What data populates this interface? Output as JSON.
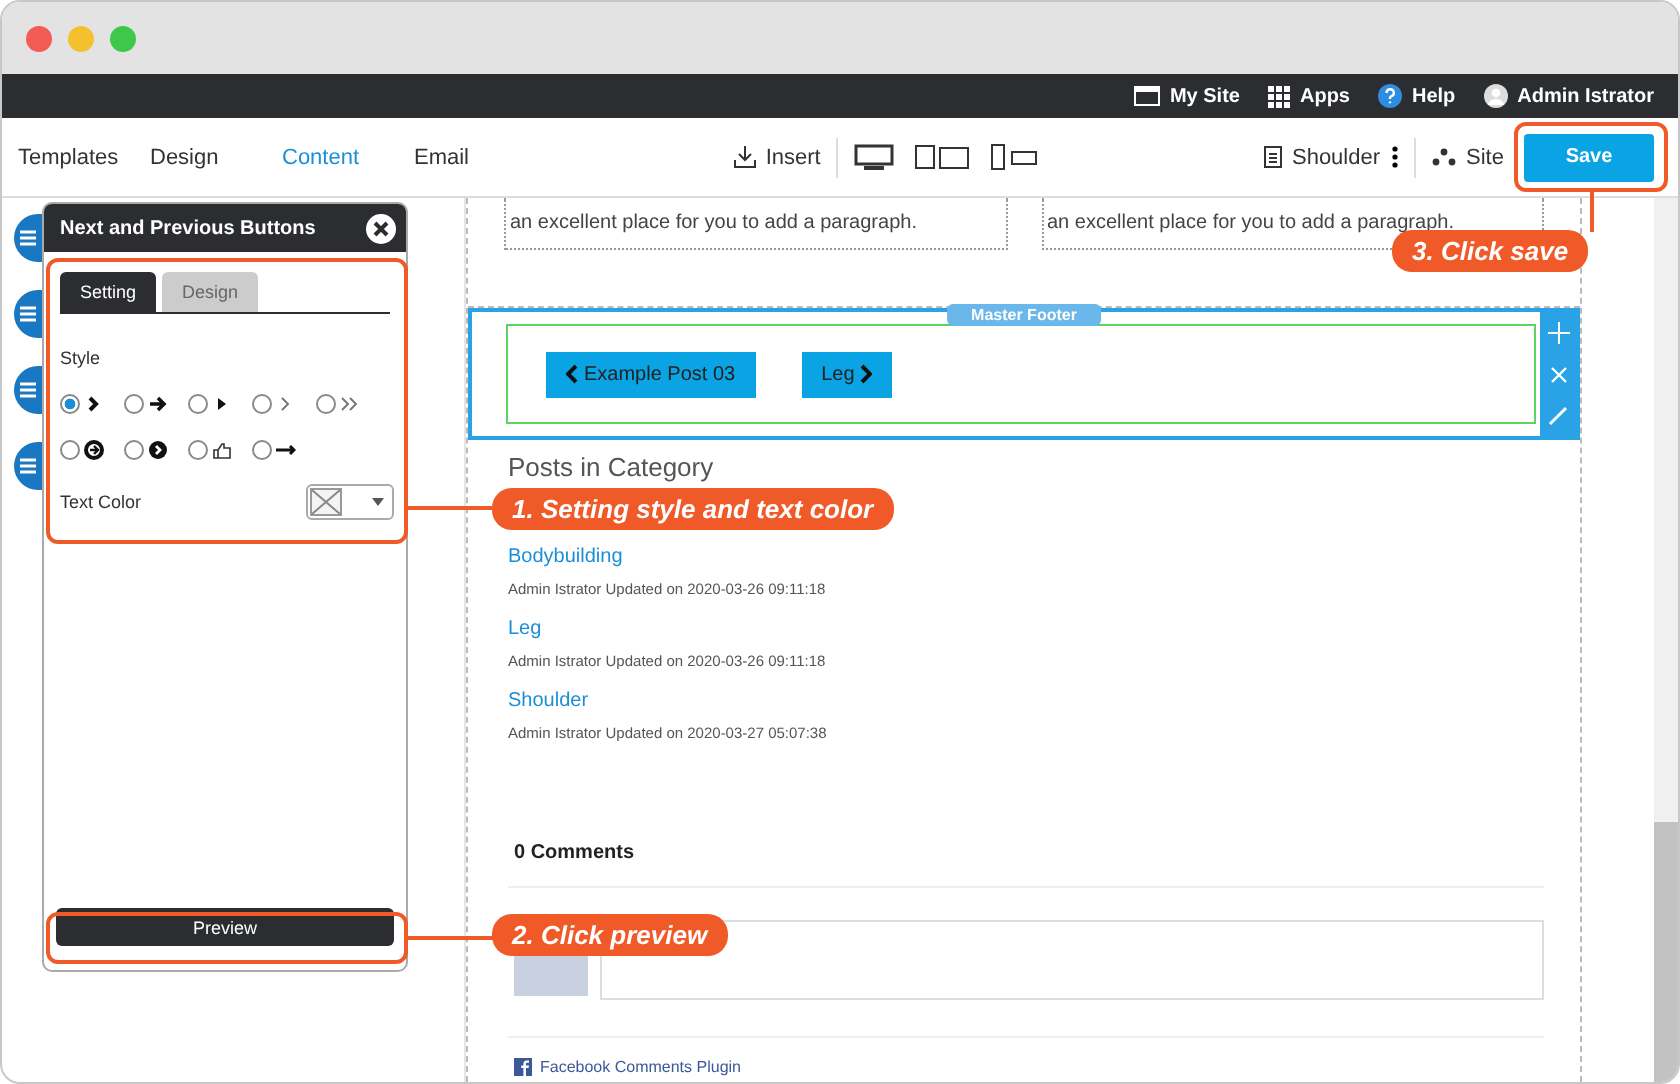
{
  "window": {
    "controls": [
      {
        "color": "#f25c54"
      },
      {
        "color": "#f5c02e"
      },
      {
        "color": "#3ec84a"
      }
    ]
  },
  "top_bar": {
    "items": [
      {
        "label": "My Site",
        "kind": "site"
      },
      {
        "label": "Apps",
        "kind": "apps"
      },
      {
        "label": "Help",
        "kind": "help"
      },
      {
        "label": "Admin Istrator",
        "kind": "user"
      }
    ]
  },
  "nav": {
    "tabs": [
      {
        "label": "Templates",
        "selected": false
      },
      {
        "label": "Design",
        "selected": false
      },
      {
        "label": "Content",
        "selected": true
      },
      {
        "label": "Email",
        "selected": false
      }
    ],
    "insert": "Insert",
    "page": "Shoulder",
    "site": "Site",
    "save": "Save"
  },
  "panel": {
    "title": "Next and Previous Buttons",
    "tabs": [
      {
        "label": "Setting",
        "selected": true
      },
      {
        "label": "Design",
        "selected": false
      }
    ],
    "style_label": "Style",
    "style_options": [
      {
        "kind": "chevron",
        "selected": true
      },
      {
        "kind": "arrow",
        "selected": false
      },
      {
        "kind": "triangle",
        "selected": false
      },
      {
        "kind": "thin-chevron",
        "selected": false
      },
      {
        "kind": "double-chevron",
        "selected": false
      },
      {
        "kind": "circle-arrow",
        "selected": false
      },
      {
        "kind": "circle-chevron",
        "selected": false
      },
      {
        "kind": "hand",
        "selected": false
      },
      {
        "kind": "long-arrow",
        "selected": false
      }
    ],
    "text_color_label": "Text Color",
    "preview": "Preview"
  },
  "page": {
    "text_boxes": [
      "an excellent place for you to add a paragraph.",
      "an excellent place for you to add a paragraph."
    ],
    "section_tag": "Master Footer",
    "nav_buttons": [
      {
        "label": "Example Post 03",
        "kind": "previous"
      },
      {
        "label": "Leg",
        "kind": "next"
      }
    ],
    "posts_heading": "Posts in Category",
    "posts": [
      {
        "title": "Bodybuilding",
        "meta": "Admin Istrator Updated on 2020-03-26 09:11:18"
      },
      {
        "title": "Leg",
        "meta": "Admin Istrator Updated on 2020-03-26 09:11:18"
      },
      {
        "title": "Shoulder",
        "meta": "Admin Istrator Updated on 2020-03-27 05:07:38"
      }
    ],
    "comments_count": "0 Comments",
    "plugin": "Facebook Comments Plugin"
  },
  "callouts": [
    {
      "label": "1. Setting style and text color"
    },
    {
      "label": "2. Click preview"
    },
    {
      "label": "3. Click save"
    }
  ]
}
